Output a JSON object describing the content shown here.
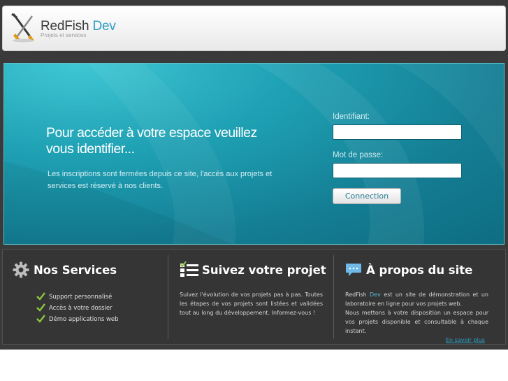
{
  "header": {
    "brand_main": "RedFish",
    "brand_accent": "Dev",
    "tagline": "Projets et services"
  },
  "hero": {
    "title": "Pour accéder à votre espace veuillez vous identifier...",
    "text": "Les inscriptions sont fermées depuis ce site, l'accès aux projets et services est réservé à nos clients."
  },
  "login": {
    "username_label": "Identifiant:",
    "username_value": "",
    "password_label": "Mot de passe:",
    "password_value": "",
    "submit_label": "Connection"
  },
  "services": {
    "title": "Nos Services",
    "items": [
      {
        "label": "Support personnalisé"
      },
      {
        "label": "Accès à votre dossier"
      },
      {
        "label": "Démo applications web"
      }
    ]
  },
  "projects": {
    "title": "Suivez votre projet",
    "text": "Suivez l'évolution de vos projets pas à pas. Toutes les étapes de vos projets sont listées et validées tout au long du développement. Informez-vous !"
  },
  "about": {
    "title": "À propos du site",
    "brand_main": "RedFish",
    "brand_accent": "Dev",
    "text_part1": " est un site de démonstration et un laboratoire en ligne pour vos projets web.",
    "text_part2": "Nous mettons à votre disposition un espace pour vos projets disponible et consultable à chaque instant.",
    "more_link": "En savoir plus"
  },
  "colors": {
    "accent": "#2a9fc4",
    "hero": "#1fa1b4",
    "panel": "#353535",
    "check": "#8cc63f"
  },
  "icons": {
    "logo": "tools-icon",
    "services": "gear-icon",
    "projects": "checklist-icon",
    "about": "chat-bubble-icon"
  }
}
